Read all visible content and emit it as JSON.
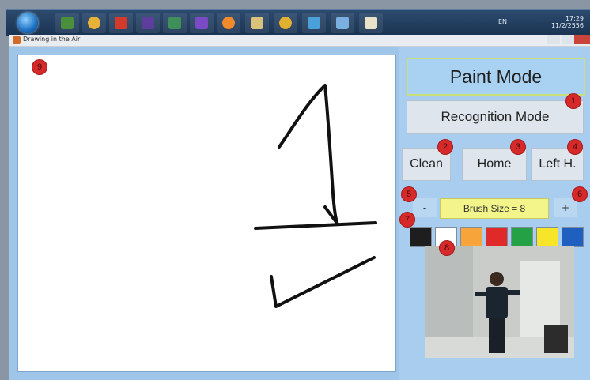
{
  "window": {
    "title": "Drawing in the Air"
  },
  "taskbar": {
    "language": "EN",
    "time": "17:29",
    "date": "11/2/2556",
    "apps": [
      {
        "icon": "windows-explorer-icon",
        "color": "#4a8f3c"
      },
      {
        "icon": "media-icon",
        "color": "#e8b23a"
      },
      {
        "icon": "pdf-reader-icon",
        "color": "#d23b2b"
      },
      {
        "icon": "visual-studio-icon",
        "color": "#5d3e9e"
      },
      {
        "icon": "spreadsheet-icon",
        "color": "#3f8f5a"
      },
      {
        "icon": "visual-studio-2-icon",
        "color": "#7a4bc4"
      },
      {
        "icon": "paint-icon",
        "color": "#f08a2a"
      },
      {
        "icon": "folder-icon",
        "color": "#d9c27a"
      },
      {
        "icon": "chrome-icon",
        "color": "#e0b030"
      },
      {
        "icon": "network-icon",
        "color": "#4aa0d8"
      },
      {
        "icon": "notepad-icon",
        "color": "#7ab0e0"
      },
      {
        "icon": "sketch-icon",
        "color": "#e7e2c8"
      }
    ]
  },
  "panel": {
    "paint_mode": "Paint Mode",
    "recognition_mode": "Recognition Mode",
    "clean": "Clean",
    "home": "Home",
    "left_hand": "Left H.",
    "minus": "-",
    "brush_size": "Brush Size = 8",
    "plus": "+",
    "swatches": [
      {
        "name": "black",
        "color": "#1e1e1e"
      },
      {
        "name": "white",
        "color": "#ffffff"
      },
      {
        "name": "orange",
        "color": "#f7a43a"
      },
      {
        "name": "red",
        "color": "#e02a2a"
      },
      {
        "name": "green",
        "color": "#25a145"
      },
      {
        "name": "yellow",
        "color": "#f7e52a"
      },
      {
        "name": "blue",
        "color": "#1f5fc0"
      }
    ]
  },
  "markers": [
    "1",
    "2",
    "3",
    "4",
    "5",
    "6",
    "7",
    "8",
    "9"
  ]
}
